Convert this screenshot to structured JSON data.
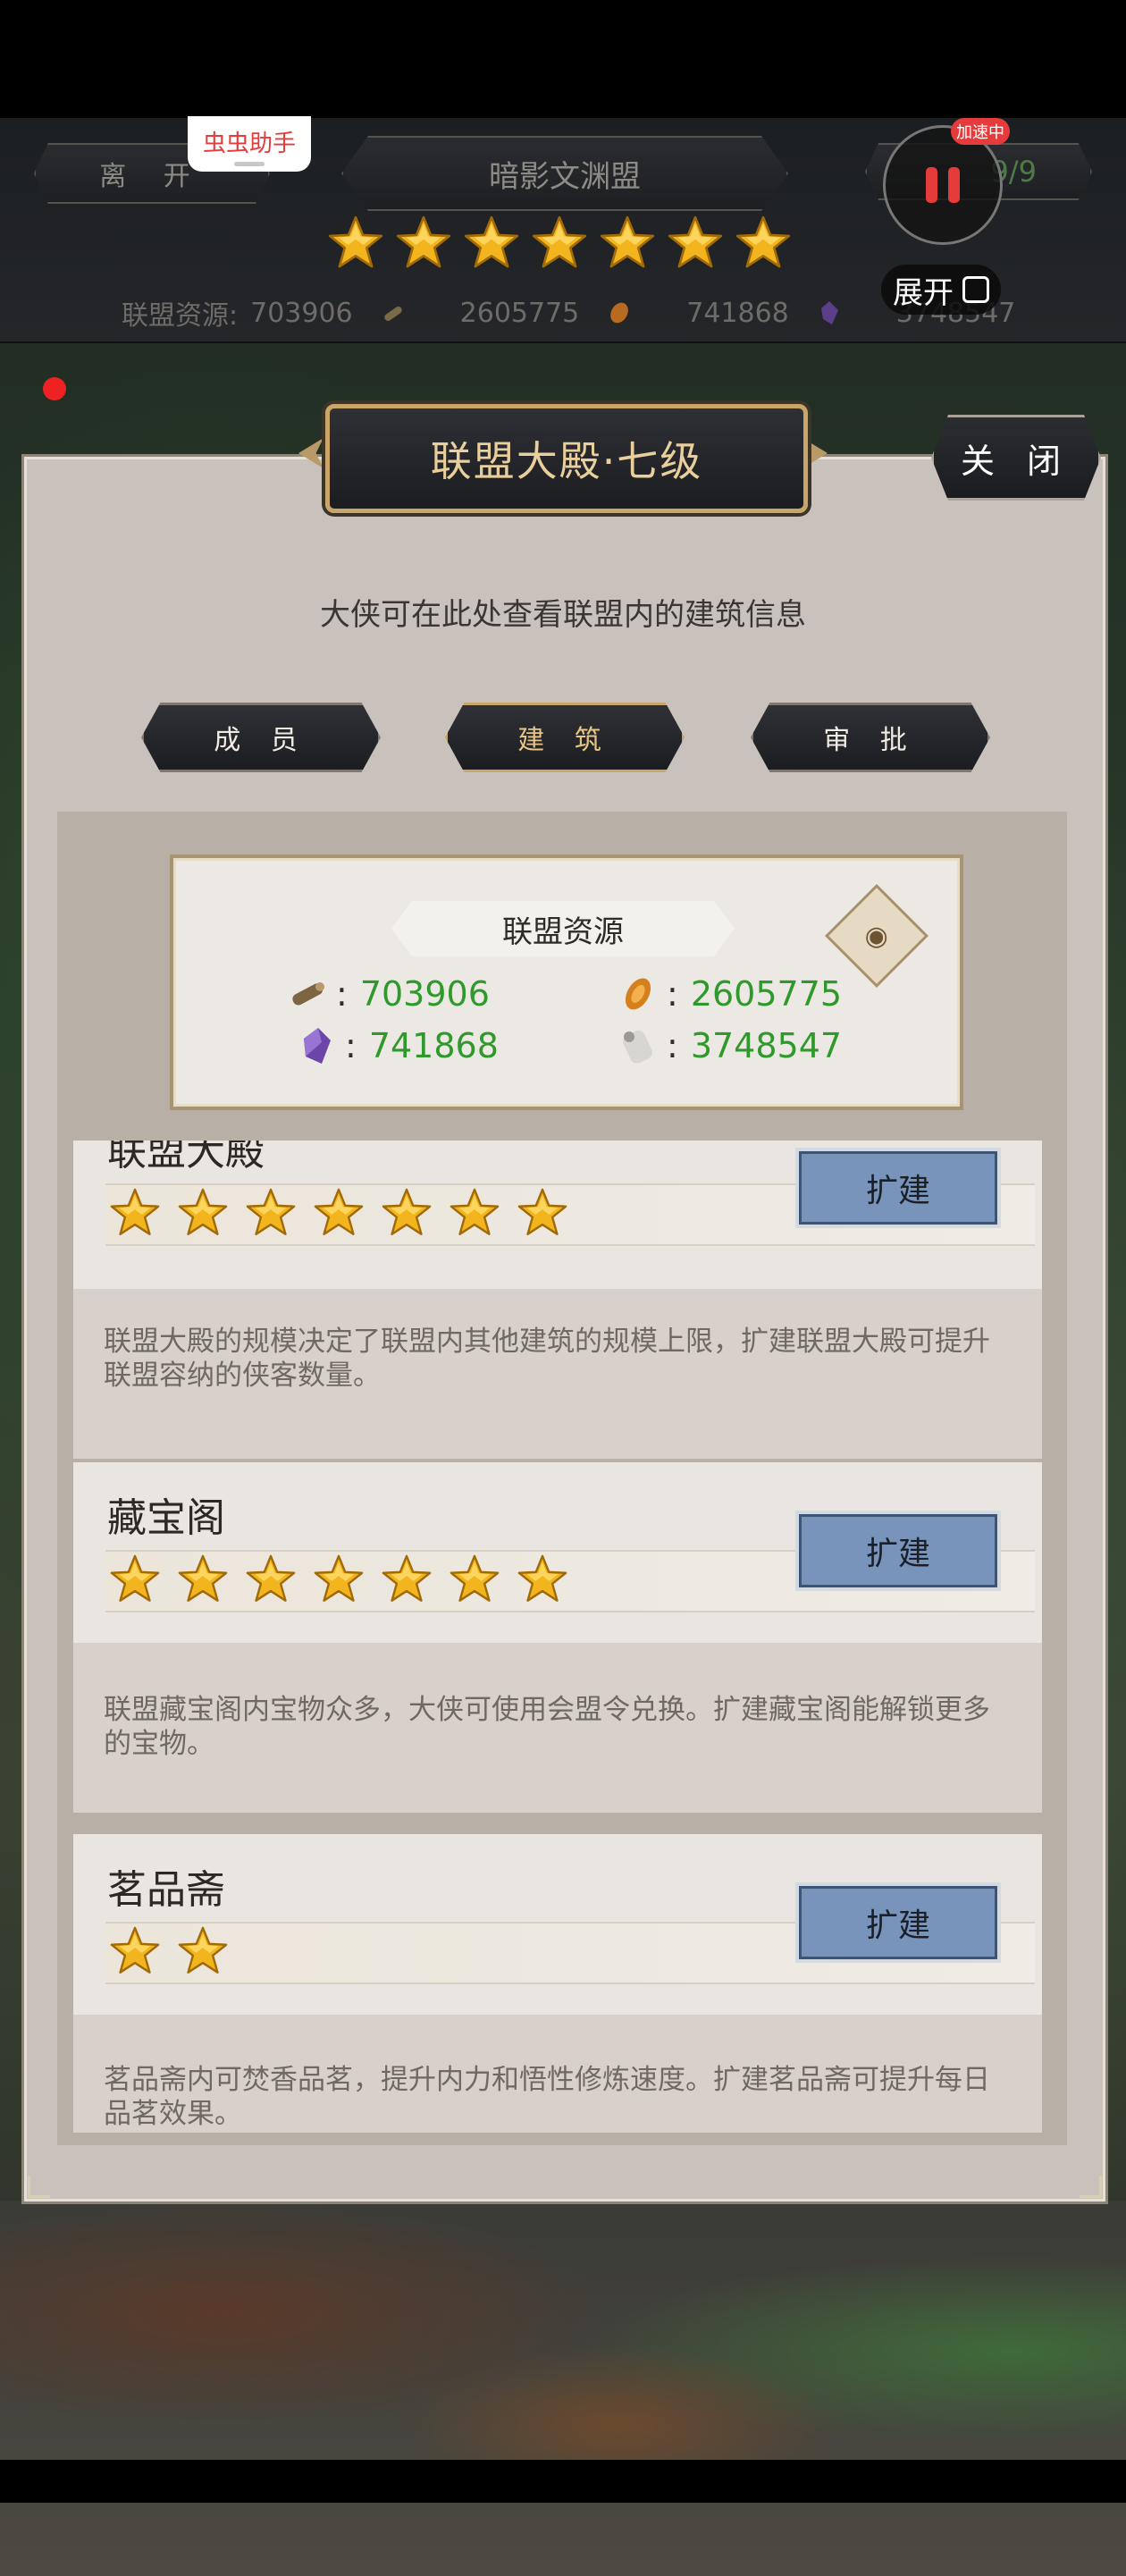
{
  "alliance": {
    "leave_label": "离 开",
    "name": "暗影文渊盟",
    "right_value": "9/9",
    "stars": 7,
    "resources_label": "联盟资源:",
    "resources": [
      "703906",
      "2605775",
      "741868",
      "3748547"
    ]
  },
  "overlay": {
    "helper_label": "虫虫助手",
    "speed_badge": "加速中",
    "expand_label": "展开"
  },
  "panel": {
    "title": "联盟大殿·七级",
    "close_label": "关 闭",
    "hint": "大侠可在此处查看联盟内的建筑信息",
    "tabs": [
      {
        "label": "成 员",
        "active": false
      },
      {
        "label": "建 筑",
        "active": true
      },
      {
        "label": "审 批",
        "active": false
      }
    ]
  },
  "resource_card": {
    "title": "联盟资源",
    "items": [
      {
        "icon": "wood-icon",
        "value": "703906"
      },
      {
        "icon": "ore-icon",
        "value": "2605775"
      },
      {
        "icon": "crystal-icon",
        "value": "741868"
      },
      {
        "icon": "scroll-icon",
        "value": "3748547"
      }
    ]
  },
  "buildings": [
    {
      "name": "联盟大殿",
      "stars": 7,
      "button": "扩建",
      "description": "联盟大殿的规模决定了联盟内其他建筑的规模上限，扩建联盟大殿可提升联盟容纳的侠客数量。"
    },
    {
      "name": "藏宝阁",
      "stars": 7,
      "button": "扩建",
      "description": "联盟藏宝阁内宝物众多，大侠可使用会盟令兑换。扩建藏宝阁能解锁更多的宝物。"
    },
    {
      "name": "茗品斋",
      "stars": 2,
      "button": "扩建",
      "description": "茗品斋内可焚香品茗，提升内力和悟性修炼速度。扩建茗品斋可提升每日品茗效果。"
    }
  ],
  "colors": {
    "star": "#f2b51d",
    "resource_value": "#2f9a2b",
    "expand_button": "#7894bb",
    "title_gold": "#e8cf9c",
    "record_red": "#e53b3b"
  }
}
